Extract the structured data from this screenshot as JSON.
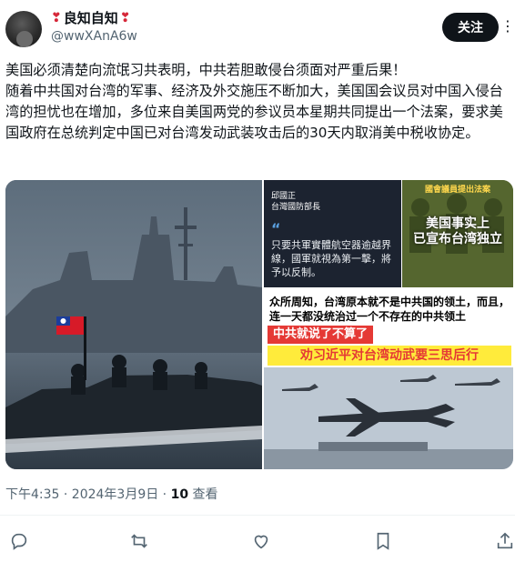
{
  "author": {
    "display_name": "良知自知",
    "handle": "@wwXAnA6w",
    "emoji": "❣"
  },
  "header": {
    "follow_label": "关注",
    "more_icon": "more-icon"
  },
  "tweet": {
    "text": "美国必须清楚向流氓习共表明，中共若胆敢侵台须面对严重后果！\n随着中共国对台湾的军事、经济及外交施压不断加大，美国国会议员对中国入侵台湾的担忧也在增加，多位来自美国两党的参议员本星期共同提出一个法案，要求美国政府在总统判定中国已对台湾发动武装攻击后的30天内取消美中税收协定。"
  },
  "media": {
    "quote_speaker": "邱國正\n台灣國防部長",
    "quote_mark": "“",
    "quote_text": "只要共軍實體航空器逾越界線，國軍就視為第一擊，將予以反制。",
    "rt_b_sub": "國會議員提出法案",
    "rt_b_title": "美国事实上\n已宣布台湾独立",
    "caption_line": "众所周知，台湾原本就不是中共国的领土，而且，连一天都没统治过一个不存在的中共领土",
    "red_bar": "中共就说了不算了",
    "yellow_title": "劝习近平对台湾动武要三思后行"
  },
  "meta": {
    "time": "下午4:35 · 2024年3月9日 · ",
    "views_count": "10",
    "views_label": " 查看"
  },
  "actions": {
    "reply": "reply-icon",
    "retweet": "retweet-icon",
    "like": "like-icon",
    "bookmark": "bookmark-icon",
    "share": "share-icon"
  }
}
